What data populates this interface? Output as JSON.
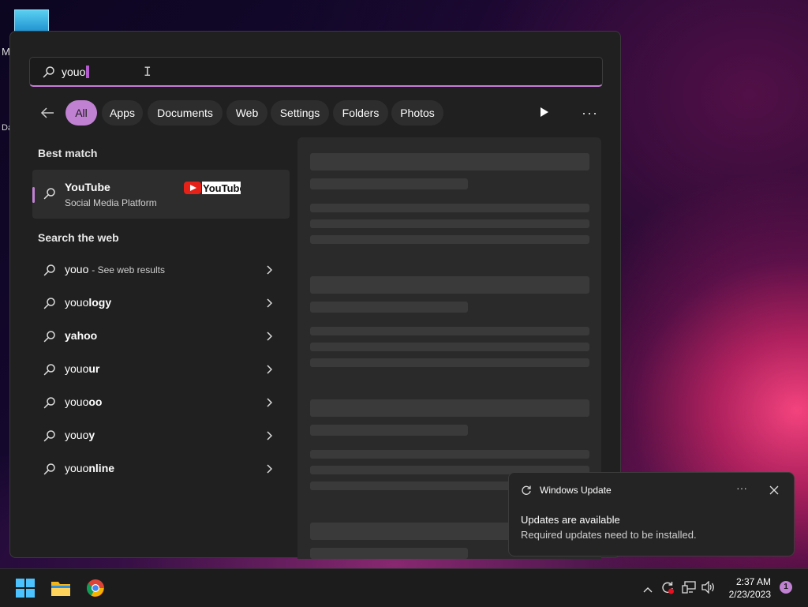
{
  "desktop": {
    "letter_m": "M",
    "letter_d": "Da"
  },
  "search": {
    "query": "youo"
  },
  "filters": {
    "chips": [
      "All",
      "Apps",
      "Documents",
      "Web",
      "Settings",
      "Folders",
      "Photos"
    ],
    "active": "All"
  },
  "best_match": {
    "heading": "Best match",
    "title": "YouTube",
    "subtitle": "Social Media Platform",
    "logo_text": "YouTube"
  },
  "web": {
    "heading": "Search the web",
    "first": {
      "query": "youo",
      "hint": "- See web results"
    },
    "suggestions": [
      {
        "prefix": "youo",
        "suffix": "logy"
      },
      {
        "prefix": "",
        "suffix": "yahoo"
      },
      {
        "prefix": "youo",
        "suffix": "ur"
      },
      {
        "prefix": "youo",
        "suffix": "oo"
      },
      {
        "prefix": "youo",
        "suffix": "y"
      },
      {
        "prefix": "youo",
        "suffix": "nline"
      }
    ]
  },
  "toast": {
    "app": "Windows Update",
    "title": "Updates are available",
    "body": "Required updates need to be installed."
  },
  "taskbar": {
    "time": "2:37 AM",
    "date": "2/23/2023",
    "notification_count": "1"
  },
  "colors": {
    "accent": "#c181d3",
    "panel": "#202020"
  }
}
